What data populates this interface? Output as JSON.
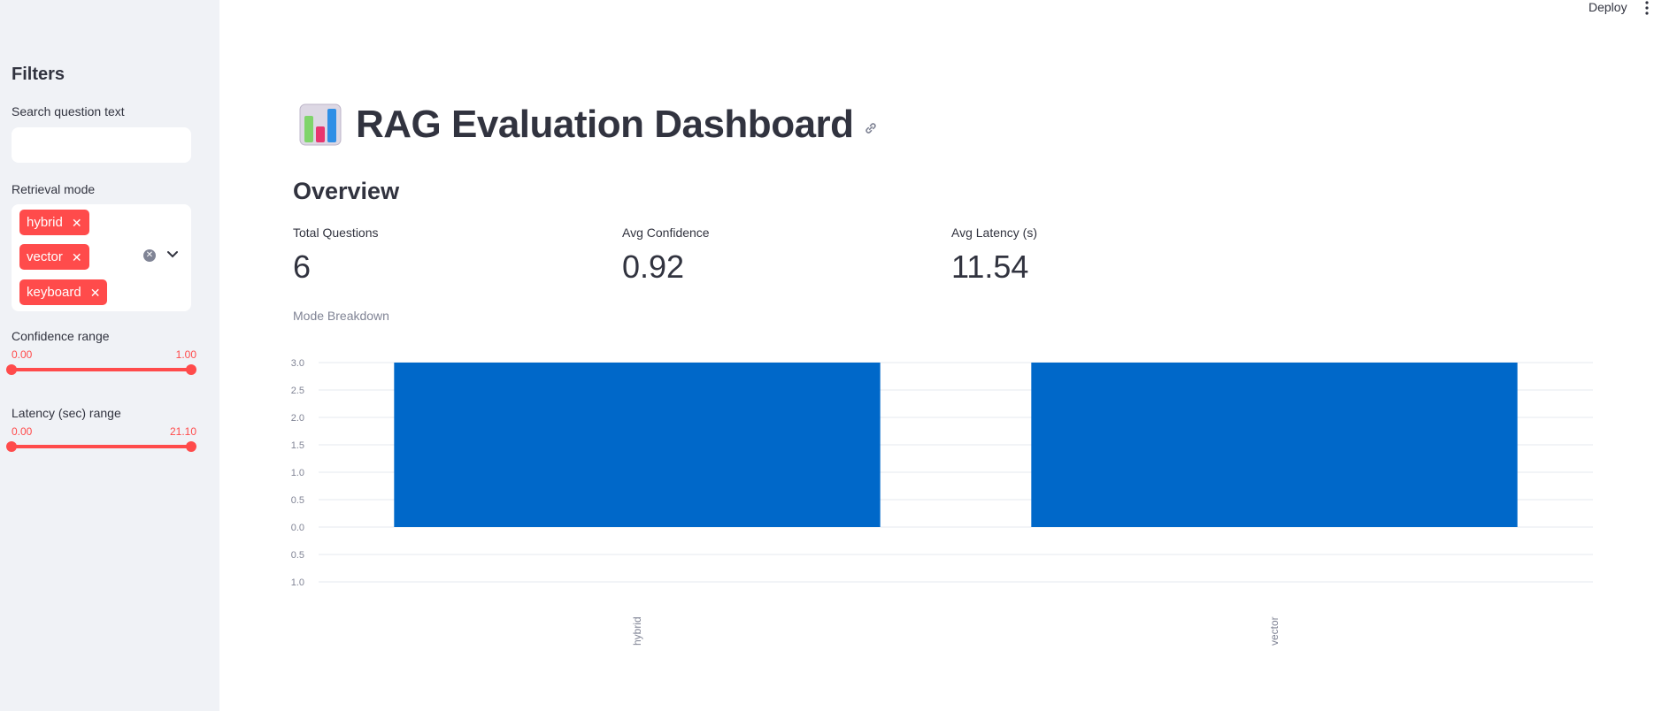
{
  "sidebar": {
    "title": "Filters",
    "search": {
      "label": "Search question text",
      "value": "",
      "placeholder": ""
    },
    "retrieval_mode": {
      "label": "Retrieval mode",
      "chips": [
        "hybrid",
        "vector",
        "keyboard"
      ]
    },
    "confidence": {
      "label": "Confidence range",
      "min": "0.00",
      "max": "1.00",
      "low": 0.0,
      "high": 1.0
    },
    "latency": {
      "label": "Latency (sec) range",
      "min": "0.00",
      "max": "21.10",
      "low": 0.0,
      "high": 21.1
    }
  },
  "header": {
    "deploy_label": "Deploy"
  },
  "main": {
    "title": "RAG Evaluation Dashboard",
    "section": "Overview",
    "metrics": [
      {
        "label": "Total Questions",
        "value": "6"
      },
      {
        "label": "Avg Confidence",
        "value": "0.92"
      },
      {
        "label": "Avg Latency (s)",
        "value": "11.54"
      }
    ],
    "chart_label": "Mode Breakdown"
  },
  "colors": {
    "accent": "#ff4b4b",
    "bar": "#0068c9",
    "sidebar_bg": "#f0f2f6",
    "text": "#31333f"
  },
  "chart_data": {
    "type": "bar",
    "categories": [
      "hybrid",
      "vector"
    ],
    "values": [
      3,
      3
    ],
    "base": 0,
    "ylim": [
      -1.0,
      3.0
    ],
    "yticks": [
      "3.0",
      "2.5",
      "2.0",
      "1.5",
      "1.0",
      "0.5",
      "0.0",
      "0.5",
      "1.0"
    ],
    "grid": true
  }
}
